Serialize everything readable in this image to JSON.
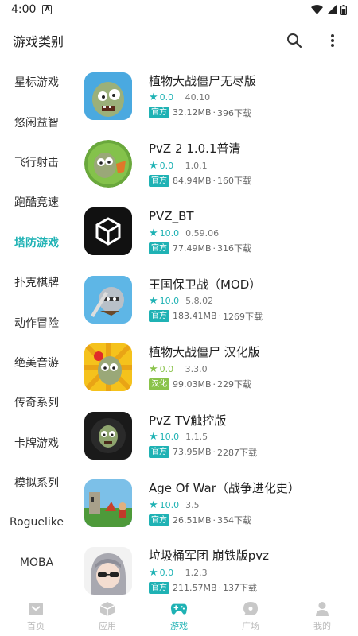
{
  "status_bar": {
    "time": "4:00",
    "app_icon": "A"
  },
  "header": {
    "title": "游戏类别"
  },
  "categories": [
    {
      "label": "星标游戏",
      "active": false
    },
    {
      "label": "悠闲益智",
      "active": false
    },
    {
      "label": "飞行射击",
      "active": false
    },
    {
      "label": "跑酷竞速",
      "active": false
    },
    {
      "label": "塔防游戏",
      "active": true
    },
    {
      "label": "扑克棋牌",
      "active": false
    },
    {
      "label": "动作冒险",
      "active": false
    },
    {
      "label": "绝美音游",
      "active": false
    },
    {
      "label": "传奇系列",
      "active": false
    },
    {
      "label": "卡牌游戏",
      "active": false
    },
    {
      "label": "模拟系列",
      "active": false
    },
    {
      "label": "Roguelike",
      "active": false
    },
    {
      "label": "MOBA",
      "active": false
    }
  ],
  "apps": [
    {
      "name": "植物大战僵尸无尽版",
      "rating": "0.0",
      "version": "40.10",
      "badge": "官方",
      "badge_color": "#1fb2b4",
      "size": "32.12MB",
      "downloads": "396下载",
      "icon": "zombie-icon"
    },
    {
      "name": "PvZ 2 1.0.1普清",
      "rating": "0.0",
      "version": "1.0.1",
      "badge": "官方",
      "badge_color": "#1fb2b4",
      "size": "84.94MB",
      "downloads": "160下载",
      "icon": "zombie-icon"
    },
    {
      "name": "PVZ_BT",
      "rating": "10.0",
      "version": "0.59.06",
      "badge": "官方",
      "badge_color": "#1fb2b4",
      "size": "77.49MB",
      "downloads": "316下载",
      "icon": "unity-icon"
    },
    {
      "name": "王国保卫战（MOD）",
      "rating": "10.0",
      "version": "5.8.02",
      "badge": "官方",
      "badge_color": "#1fb2b4",
      "size": "183.41MB",
      "downloads": "1269下载",
      "icon": "knight-icon"
    },
    {
      "name": "植物大战僵尸 汉化版",
      "rating": "0.0",
      "version": "3.3.0",
      "badge": "汉化",
      "badge_color": "#8ac34a",
      "size": "99.03MB",
      "downloads": "229下载",
      "icon": "zombie-icon"
    },
    {
      "name": "PvZ TV触控版",
      "rating": "10.0",
      "version": "1.1.5",
      "badge": "官方",
      "badge_color": "#1fb2b4",
      "size": "73.95MB",
      "downloads": "2287下载",
      "icon": "zombie-icon"
    },
    {
      "name": "Age Of War（战争进化史）",
      "rating": "10.0",
      "version": "3.5",
      "badge": "官方",
      "badge_color": "#1fb2b4",
      "size": "26.51MB",
      "downloads": "354下载",
      "icon": "battle-icon"
    },
    {
      "name": "垃圾桶军团 崩铁版pvz",
      "rating": "0.0",
      "version": "1.2.3",
      "badge": "官方",
      "badge_color": "#1fb2b4",
      "size": "211.57MB",
      "downloads": "137下载",
      "icon": "anime-girl-icon"
    }
  ],
  "tabs": [
    {
      "label": "首页",
      "icon": "home-icon",
      "active": false
    },
    {
      "label": "应用",
      "icon": "box-icon",
      "active": false
    },
    {
      "label": "游戏",
      "icon": "gamepad-icon",
      "active": true
    },
    {
      "label": "广场",
      "icon": "chat-icon",
      "active": false
    },
    {
      "label": "我的",
      "icon": "person-icon",
      "active": false
    }
  ],
  "colors": {
    "accent": "#1fb2b4",
    "badge_green": "#8ac34a",
    "inactive": "#bbbbbb"
  }
}
